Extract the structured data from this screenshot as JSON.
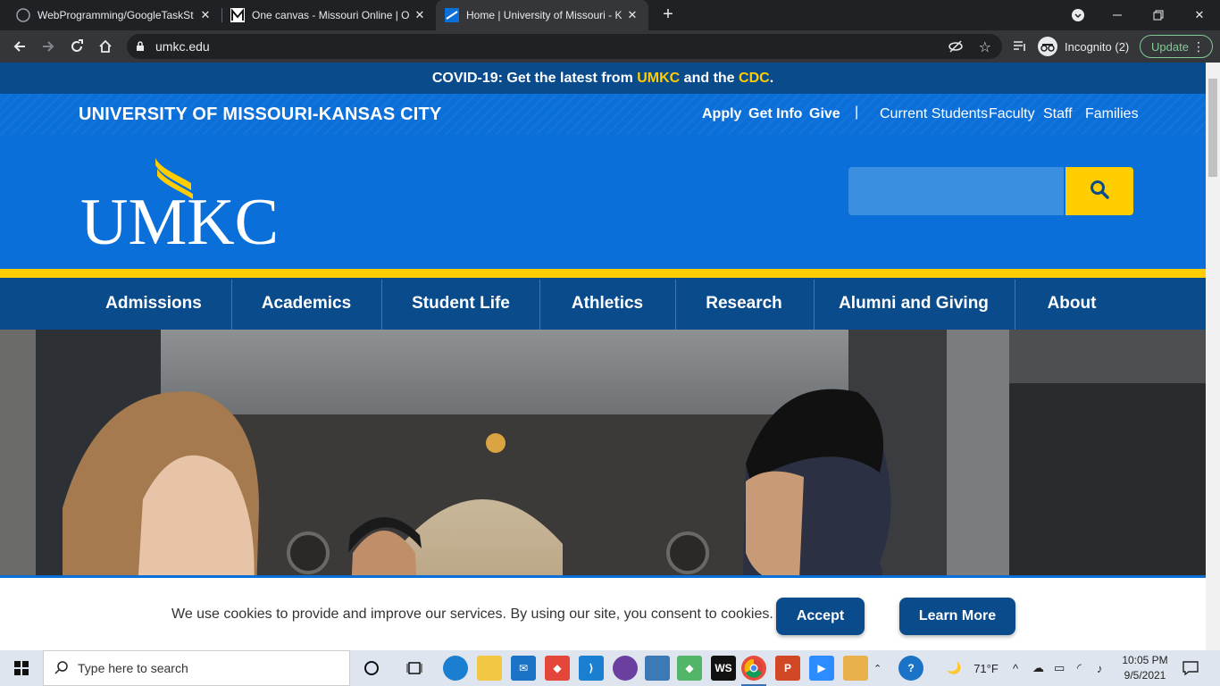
{
  "browser": {
    "tabs": [
      {
        "title": "WebProgramming/GoogleTaskSt",
        "active": false
      },
      {
        "title": "One canvas - Missouri Online | O",
        "active": false
      },
      {
        "title": "Home | University of Missouri - K",
        "active": true
      }
    ],
    "url": "umkc.edu",
    "profile_label": "Incognito (2)",
    "update_label": "Update"
  },
  "covid_banner": {
    "prefix": "COVID-19: Get the latest from ",
    "link1": "UMKC",
    "middle": " and the ",
    "link2": "CDC",
    "suffix": "."
  },
  "header": {
    "university_name": "UNIVERSITY OF MISSOURI-KANSAS CITY",
    "utility_primary": [
      "Apply",
      "Get Info",
      "Give"
    ],
    "utility_separator": "|",
    "utility_audience": [
      "Current Students",
      "Faculty",
      "Staff",
      "Families"
    ],
    "logo_text": "UMKC",
    "search_placeholder": ""
  },
  "nav": {
    "items": [
      "Admissions",
      "Academics",
      "Student Life",
      "Athletics",
      "Research",
      "Alumni and Giving",
      "About"
    ]
  },
  "cookie_banner": {
    "message": "We use cookies to provide and improve our services. By using our site, you consent to cookies.",
    "accept_label": "Accept",
    "learn_more_label": "Learn More"
  },
  "taskbar": {
    "search_placeholder": "Type here to search",
    "weather": "71°F",
    "time": "10:05 PM",
    "date": "9/5/2021"
  },
  "colors": {
    "umkc_blue": "#0b6fd9",
    "umkc_navy": "#0a4b8c",
    "umkc_gold": "#ffcd00"
  }
}
